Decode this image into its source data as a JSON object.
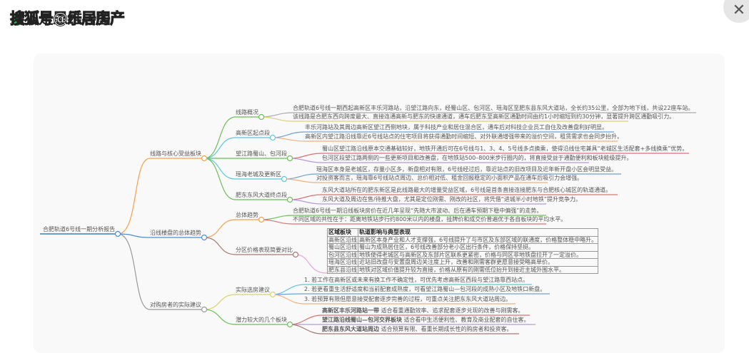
{
  "header": {
    "title": "以下是思维导图",
    "watermark": "搜狐号@乐居房产",
    "close": "✕"
  },
  "mindmap": {
    "root": "合肥轨道6号线一期分析报告",
    "b1": {
      "label": "线路与核心受益板块",
      "c1": {
        "label": "线路概况",
        "leaves": [
          "合肥轨道6号线一期西起高新区丰乐河路站，沿望江路向东，经蜀山区、包河区、瑶海区至肥东县东风大道站，全长约35公里，全部为地下线，共设22座车站。",
          "该线路是合肥东西向跨度最大、直接连通高新与肥东的快速通道，通车后肥东至高新区通勤时间由约1小时缩短到约30分钟，显著提升跨区通勤吸引力。"
        ]
      },
      "c2": {
        "label": "高新区起点段",
        "leaves": [
          "丰乐河路站及其周边高新区望江西侧地块，属于科技产业和居住混合区，通车后对科技企业员工自住及改善盘利好明显。",
          "高新区内望江路沿线靠近6号线站点的住宅项目将获得通勤时间缩短、对外联通增强带来的溢价空间，租赁需求也会同步抬升。"
        ]
      },
      "c3": {
        "label": "望江路蜀山、包河段",
        "leaves": [
          "蜀山区望江路沿线原本交通基础较好，地铁开通后可在6号线与1、3、4、5号线多点换乘，使得沿线住宅兼具“老城区生活配套+多线换乘”优势。",
          "包河区段望江路两侧的一些更新项目和改善盘，在地铁站500–800米步行圈内的，将直接受益于通勤便利和板块能级提升。"
        ]
      },
      "c4": {
        "label": "瑶海老城及更新区",
        "leaves": [
          "瑶海区本身是老城区，存量小区多，新盘相对有限，6号线经过后，靠近站点的旧改项目及近年新开盘小区会明显受益。",
          "对投资客而言，瑶海靠6号线站点周边、总价相对低、租金回报稳定的小面积产品在通车后吸引力会增强。"
        ]
      },
      "c5": {
        "label": "肥东东风大道终点段",
        "leaves": [
          "东风大道站所在的肥东新区是此线路最大的增量受益区域，6号线是首条直接连接肥东与合肥核心城区的轨道通道。",
          "东风大道及周边在售/待推大盘，尤其是定位刚需、刚改的社区，将凭借“进城半小时地铁”提升竞争力。"
        ]
      }
    },
    "b2": {
      "label": "沿线楼盘的总体趋势",
      "c1": {
        "label": "总体趋势",
        "leaves": [
          "合肥轨道6号线一期沿线板块房价在近几年呈现“先随大市波动、后在通车预期下稳中偏强”的走势。",
          "不同区域的共性在于：距离地铁站步行约800米以内的楼盘，挂牌价和成交价普遍优于各自板块的平均水平。"
        ]
      },
      "c2": {
        "label": "分区价格表现简要对比",
        "table": {
          "headers": [
            "区域板块",
            "轨道影响与典型表现"
          ],
          "rows": [
            [
              "高新区沿线",
              "高新区本身产业和人才支撑强，6号线提升了与市区及东部区域的联通度，价格整体稳中略升。"
            ],
            [
              "蜀山区沿线",
              "蜀山为成熟居住区，6号线改善部分老小区出行条件，价格保持坚挺。"
            ],
            [
              "包河区沿线",
              "地铁使得老城区与高新区及东部片区联系更紧密，价格与同区非地铁盘拉开了一定溢价。"
            ],
            [
              "瑶海区沿线",
              "近站旧改盘与安置盘周边关注度上升，改善和刚需客群更愿意接受略高单价。"
            ],
            [
              "肥东县沿线",
              "地铁对区域价值提升较为直接，价格从原有的刚需低位抬升到接近主城外围水平。"
            ]
          ]
        }
      }
    },
    "b3": {
      "label": "对购房者的实际建议",
      "c1": {
        "label": "实际选房建议",
        "leaves": [
          "1. 若工作在高新区或未来有换工作不确定性，可优先考虑高新区西段与望江路靠西站点。",
          "2. 若更看重生活舒适度和当前配套成熟度，可看望江路蜀山—包河段的成熟小区及地铁口新盘。",
          "3. 若预算有限但愿意接受配套逐步完善的过程，可重点关注肥东东风大道站周边。"
        ]
      },
      "c2": {
        "label": "潜力较大的几个板块",
        "leaves": [
          {
            "name": "高新区丰乐河路站一带",
            "desc": "适合看重通勤效率、追求配套逐步兑现的改善与刚需客。"
          },
          {
            "name": "望江路沿线蜀山—包河交界板块",
            "desc": "适合看中生活便利性、教育及商业配套的自住客。"
          },
          {
            "name": "肥东县东风大道站周边",
            "desc": "适合预算有限、看重长期成长性的购房者和投资客。"
          }
        ]
      }
    }
  }
}
